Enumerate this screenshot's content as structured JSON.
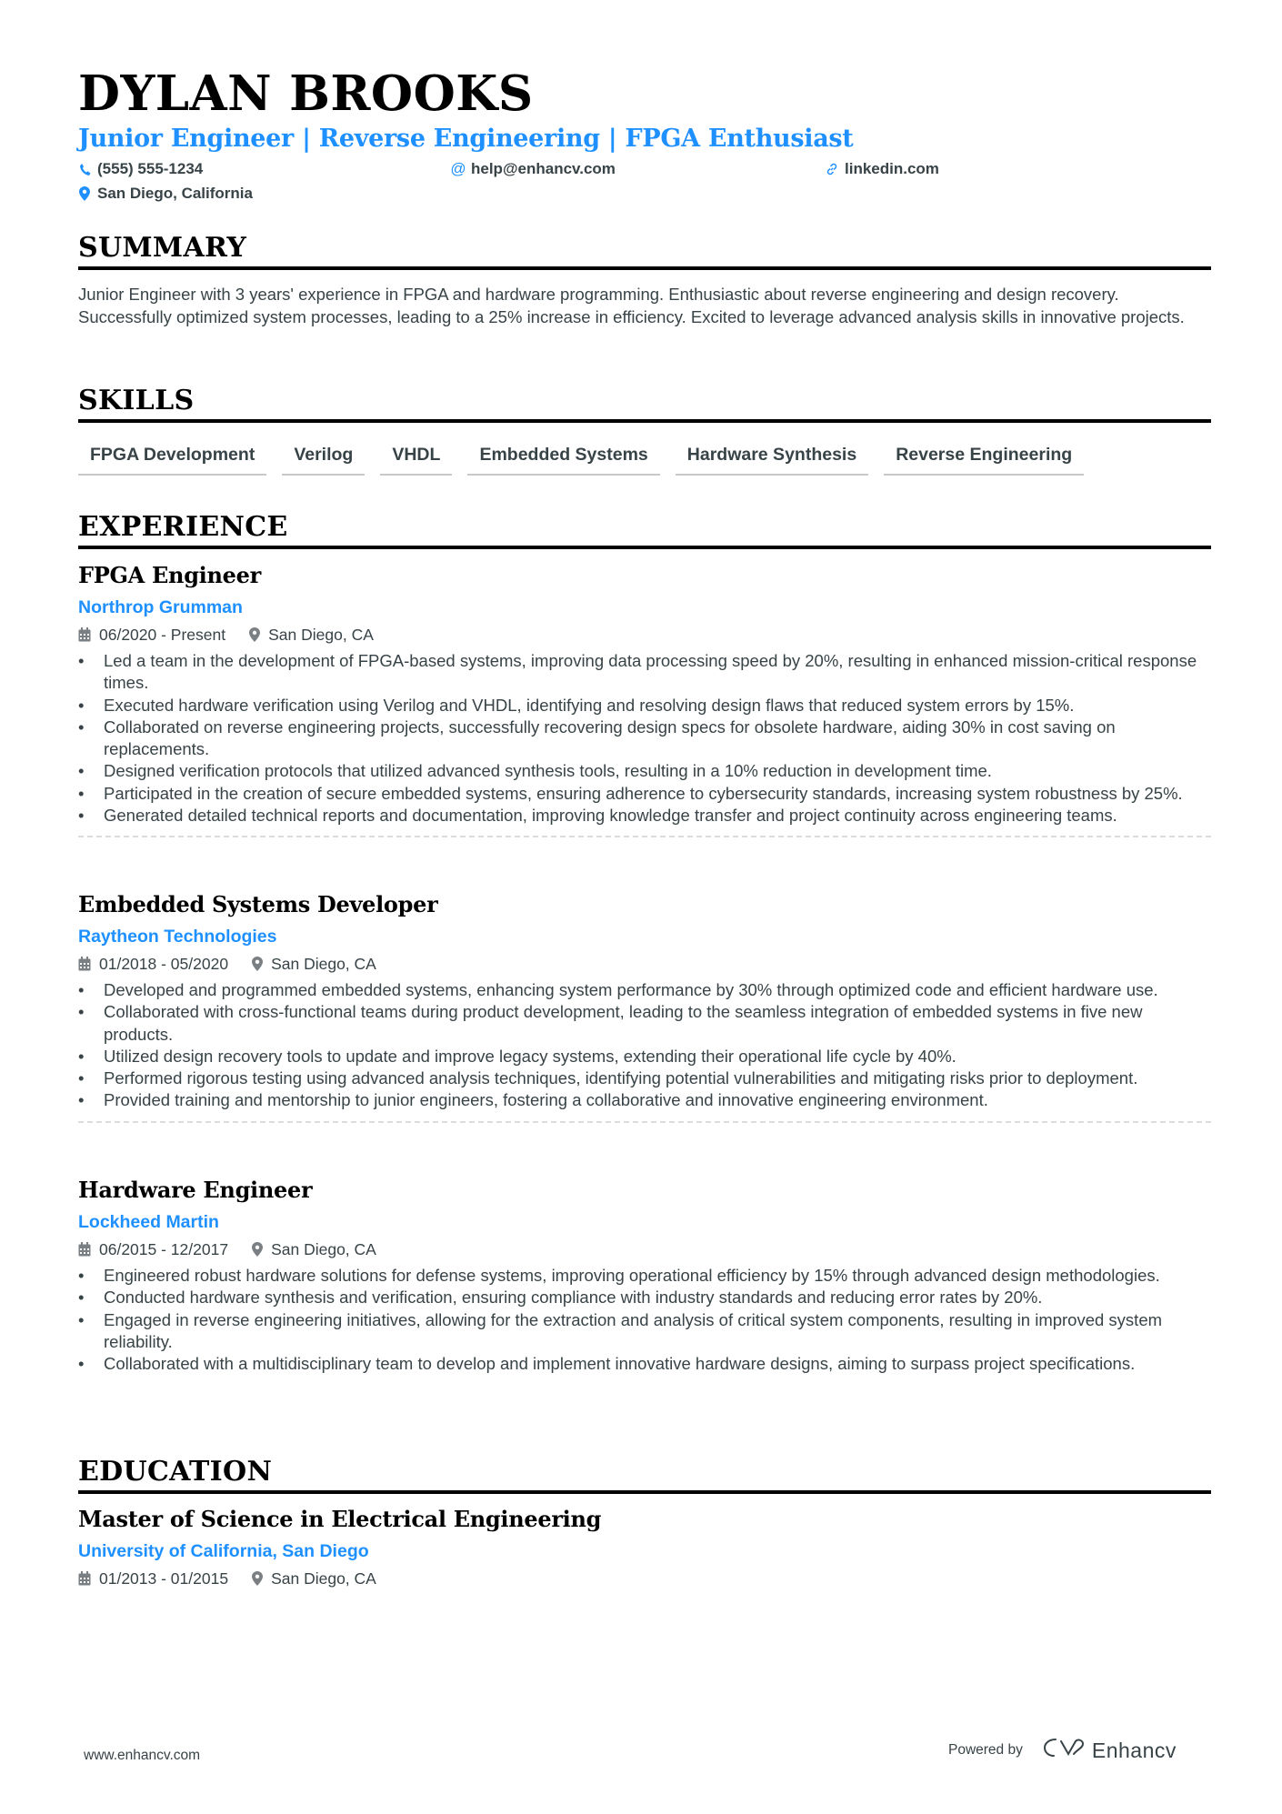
{
  "header": {
    "name": "DYLAN BROOKS",
    "headline": "Junior Engineer | Reverse Engineering | FPGA Enthusiast",
    "phone": "(555) 555-1234",
    "email": "help@enhancv.com",
    "link": "linkedin.com",
    "location": "San Diego, California"
  },
  "colors": {
    "accent": "#1e90ff",
    "text": "#384347",
    "heading": "#000000"
  },
  "summary": {
    "title": "SUMMARY",
    "text": "Junior Engineer with 3 years' experience in FPGA and hardware programming. Enthusiastic about reverse engineering and design recovery. Successfully optimized system processes, leading to a 25% increase in efficiency. Excited to leverage advanced analysis skills in innovative projects."
  },
  "skills": {
    "title": "SKILLS",
    "items": [
      "FPGA Development",
      "Verilog",
      "VHDL",
      "Embedded Systems",
      "Hardware Synthesis",
      "Reverse Engineering"
    ]
  },
  "experience": {
    "title": "EXPERIENCE",
    "items": [
      {
        "role": "FPGA Engineer",
        "company": "Northrop Grumman",
        "dates": "06/2020 - Present",
        "location": "San Diego, CA",
        "bullets": [
          "Led a team in the development of FPGA-based systems, improving data processing speed by 20%, resulting in enhanced mission-critical response times.",
          "Executed hardware verification using Verilog and VHDL, identifying and resolving design flaws that reduced system errors by 15%.",
          "Collaborated on reverse engineering projects, successfully recovering design specs for obsolete hardware, aiding 30% in cost saving on replacements.",
          "Designed verification protocols that utilized advanced synthesis tools, resulting in a 10% reduction in development time.",
          "Participated in the creation of secure embedded systems, ensuring adherence to cybersecurity standards, increasing system robustness by 25%.",
          "Generated detailed technical reports and documentation, improving knowledge transfer and project continuity across engineering teams."
        ]
      },
      {
        "role": "Embedded Systems Developer",
        "company": "Raytheon Technologies",
        "dates": "01/2018 - 05/2020",
        "location": "San Diego, CA",
        "bullets": [
          "Developed and programmed embedded systems, enhancing system performance by 30% through optimized code and efficient hardware use.",
          "Collaborated with cross-functional teams during product development, leading to the seamless integration of embedded systems in five new products.",
          "Utilized design recovery tools to update and improve legacy systems, extending their operational life cycle by 40%.",
          "Performed rigorous testing using advanced analysis techniques, identifying potential vulnerabilities and mitigating risks prior to deployment.",
          "Provided training and mentorship to junior engineers, fostering a collaborative and innovative engineering environment."
        ]
      },
      {
        "role": "Hardware Engineer",
        "company": "Lockheed Martin",
        "dates": "06/2015 - 12/2017",
        "location": "San Diego, CA",
        "bullets": [
          "Engineered robust hardware solutions for defense systems, improving operational efficiency by 15% through advanced design methodologies.",
          "Conducted hardware synthesis and verification, ensuring compliance with industry standards and reducing error rates by 20%.",
          "Engaged in reverse engineering initiatives, allowing for the extraction and analysis of critical system components, resulting in improved system reliability.",
          "Collaborated with a multidisciplinary team to develop and implement innovative hardware designs, aiming to surpass project specifications."
        ]
      }
    ]
  },
  "education": {
    "title": "EDUCATION",
    "items": [
      {
        "degree": "Master of Science in Electrical Engineering",
        "school": "University of California, San Diego",
        "dates": "01/2013 - 01/2015",
        "location": "San Diego, CA"
      }
    ]
  },
  "footer": {
    "website": "www.enhancv.com",
    "powered_by": "Powered by",
    "brand": "Enhancv"
  },
  "icons": {
    "phone": "phone-icon",
    "email": "at-icon",
    "link": "link-icon",
    "location": "map-pin-icon",
    "date": "calendar-icon"
  }
}
